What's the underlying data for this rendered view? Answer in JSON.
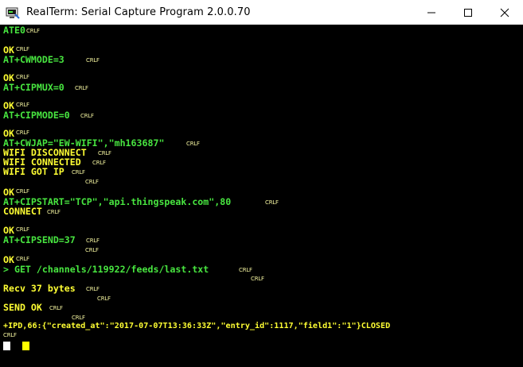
{
  "window": {
    "title": "RealTerm: Serial Capture Program 2.0.0.70",
    "app_icon": "serial-terminal-icon",
    "minimize_glyph": "—",
    "maximize_glyph": "☐",
    "close_glyph": "✕"
  },
  "colors": {
    "sent": "#48e640",
    "received": "#ffff33",
    "crlf": "#f5f5a0",
    "background": "#000000"
  },
  "terminal": {
    "crlf_marker": "CRLF",
    "lines": [
      "ATE0",
      "OK",
      "AT+CWMODE=3",
      "OK",
      "AT+CIPMUX=0",
      "OK",
      "AT+CIPMODE=0",
      "OK",
      "AT+CWJAP=\"EW-WIFI\",\"mh163687\"",
      "WIFI DISCONNECT",
      "WIFI CONNECTED",
      "WIFI GOT IP",
      "OK",
      "AT+CIPSTART=\"TCP\",\"api.thingspeak.com\",80",
      "CONNECT",
      "OK",
      "AT+CIPSEND=37",
      "OK",
      "> GET /channels/119922/feeds/last.txt",
      "Recv 37 bytes",
      "SEND OK",
      "+IPD,66:{\"created_at\":\"2017-07-07T13:36:33Z\",\"entry_id\":1117,\"field1\":\"1\"}CLOSED"
    ]
  }
}
